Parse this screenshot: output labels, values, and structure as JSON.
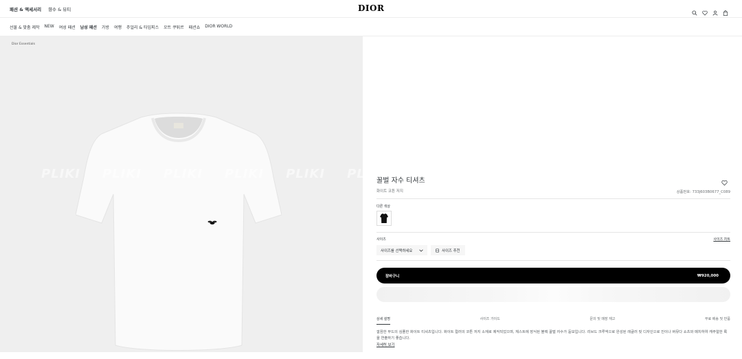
{
  "topbar": {
    "links": [
      "패션 & 액세서리",
      "향수 & 뷰티"
    ],
    "logo": "DIOR"
  },
  "nav": {
    "items": [
      "선물 & 맞춤 제작",
      "NEW",
      "여성 패션",
      "남성 패션",
      "가방",
      "여행",
      "주얼리 & 타임피스",
      "오트 쿠튀르",
      "패션쇼",
      "DIOR WORLD"
    ]
  },
  "gallery": {
    "breadcrumb": "Dior Essentials",
    "watermark": [
      "PLIKI",
      "PLIKI",
      "PLIKI",
      "PLIKI",
      "PLIKI",
      "PLIKI"
    ]
  },
  "product": {
    "title": "꿀벌 자수 티셔츠",
    "subtitle": "화이트 코튼 저지",
    "sku": "상품번호: 733J603B0677_C089",
    "color_label": "다른 색상",
    "size_label": "사이즈",
    "size_guide": "사이즈 차트",
    "size_select": "사이즈를 선택하세요",
    "size_recommend": "사이즈 추천",
    "cart_label": "장바구니",
    "price": "₩920,000"
  },
  "tabs": [
    "상세 설명",
    "사이즈 가이드",
    "문의 및 매장 재고",
    "무료 배송 및 반품"
  ],
  "description": "깔끔한 무드의 심플한 화이트 티셔츠입니다. 화이트 컬러의 코튼 저지 소재로 제작되었으며, 체스트에 장식된 블랙 꿀벌 자수가 돋보입니다. 리브드 크루넥으로 완성된 레귤러 핏 디자인으로 진이나 버뮤다 쇼츠와 매치하여 캐주얼한 룩을 연출하기 좋습니다.",
  "more_link": "자세히 보기",
  "colors": {
    "black": "#000000",
    "text": "#33383c"
  }
}
